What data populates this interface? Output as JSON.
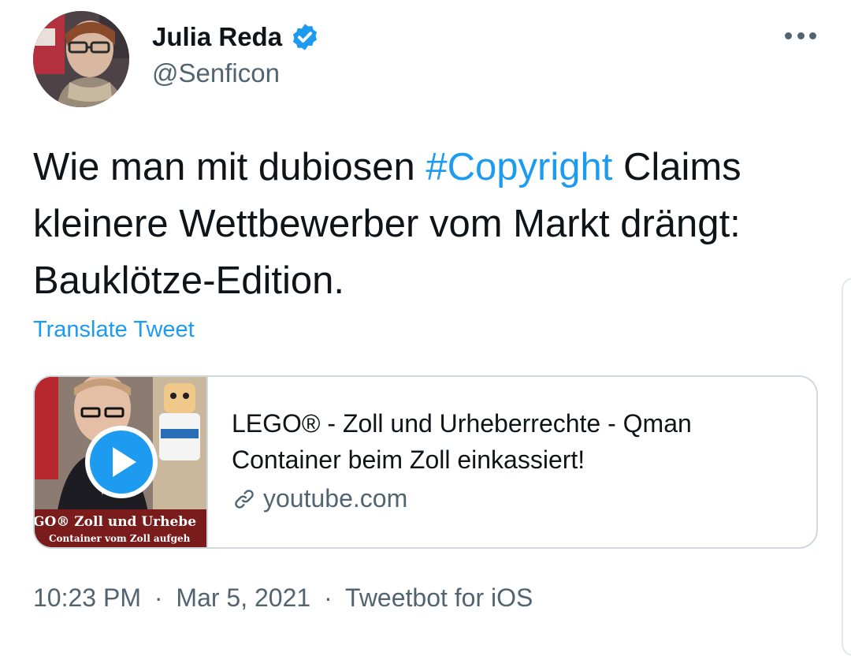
{
  "author": {
    "display_name": "Julia Reda",
    "handle": "@Senficon",
    "avatar_icon": "avatar-photo",
    "verified_icon": "verified-badge-icon"
  },
  "tweet": {
    "text_before": "Wie man mit dubiosen ",
    "hashtag": "#Copyright",
    "text_after": " Claims kleinere Wettbewerber vom Markt drängt: Bauklötze-Edition.",
    "translate_label": "Translate Tweet"
  },
  "card": {
    "thumbnail_text_1": "GO® Zoll und Urhebe",
    "thumbnail_text_2": "Container vom Zoll aufgeh",
    "title": "LEGO® - Zoll und Urheberrechte - Qman Container beim Zoll einkassiert!",
    "domain": "youtube.com"
  },
  "meta": {
    "time": "10:23 PM",
    "separator": "·",
    "date": "Mar 5, 2021",
    "source": "Tweetbot for iOS"
  },
  "colors": {
    "accent": "#1d9bf0",
    "text": "#0f1419",
    "secondary": "#536471",
    "border": "#cfd9de"
  }
}
